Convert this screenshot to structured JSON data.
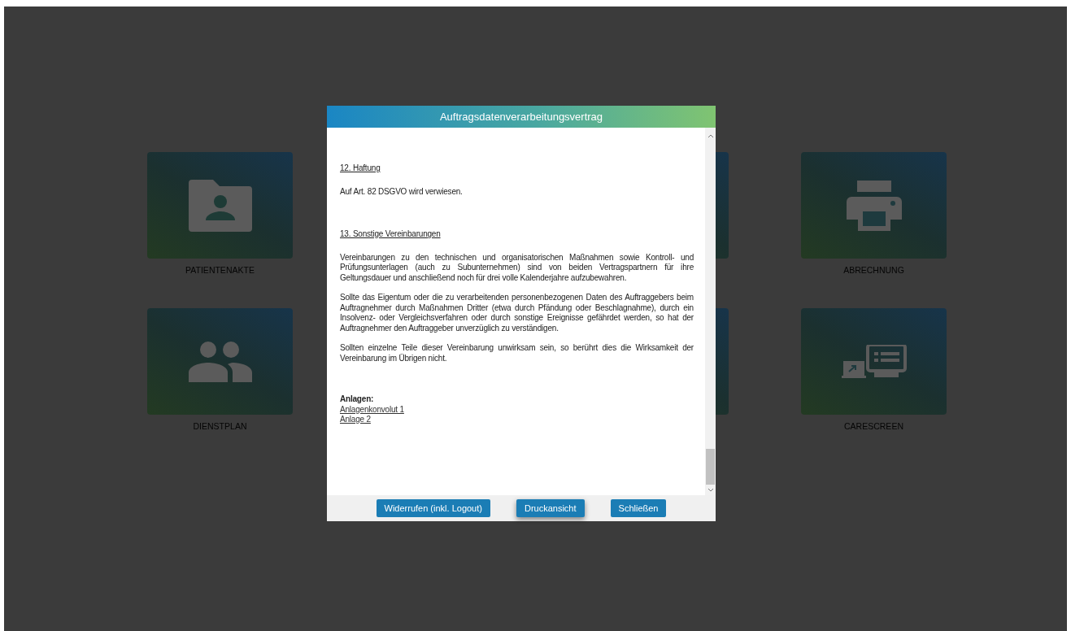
{
  "tiles": [
    {
      "label": "PATIENTENAKTE",
      "kind": "folder"
    },
    {
      "label": "ABRECHNUNG",
      "kind": "printer"
    },
    {
      "label": "DIENSTPLAN",
      "kind": "people"
    },
    {
      "label": "CARESCREEN",
      "kind": "screen"
    }
  ],
  "dialog": {
    "title": "Auftragsdatenverarbeitungsvertrag",
    "content": [
      {
        "kind": "heading",
        "text": "12. Haftung"
      },
      {
        "kind": "paragraph",
        "text": "Auf Art. 82 DSGVO wird verwiesen."
      },
      {
        "kind": "heading",
        "text": "13. Sonstige Vereinbarungen"
      },
      {
        "kind": "paragraph",
        "text": "Vereinbarungen zu den technischen und organisatorischen Maßnahmen sowie Kontroll- und Prüfungsunterlagen (auch zu Subunternehmen) sind von beiden Vertragspartnern für ihre Geltungsdauer und anschließend noch für drei volle Kalenderjahre aufzubewahren."
      },
      {
        "kind": "paragraph",
        "text": "Sollte das Eigentum oder die zu verarbeitenden personenbezogenen Daten des Auftraggebers beim Auftragnehmer durch Maßnahmen Dritter (etwa durch Pfändung oder Beschlagnahme), durch ein Insolvenz- oder Vergleichsverfahren oder durch sonstige Ereignisse gefährdet werden, so hat der Auftragnehmer den Auftraggeber unverzüglich zu verständigen."
      },
      {
        "kind": "paragraph",
        "text": "Sollten einzelne Teile dieser Vereinbarung unwirksam sein, so berührt dies die Wirksamkeit der Vereinbarung im Übrigen nicht."
      }
    ],
    "attachments": {
      "label": "Anlagen:",
      "links": [
        "Anlagenkonvolut 1",
        "Anlage 2"
      ]
    },
    "buttons": [
      {
        "label": "Widerrufen (inkl. Logout)",
        "focused": false
      },
      {
        "label": "Druckansicht",
        "focused": true
      },
      {
        "label": "Schließen",
        "focused": false
      }
    ]
  }
}
